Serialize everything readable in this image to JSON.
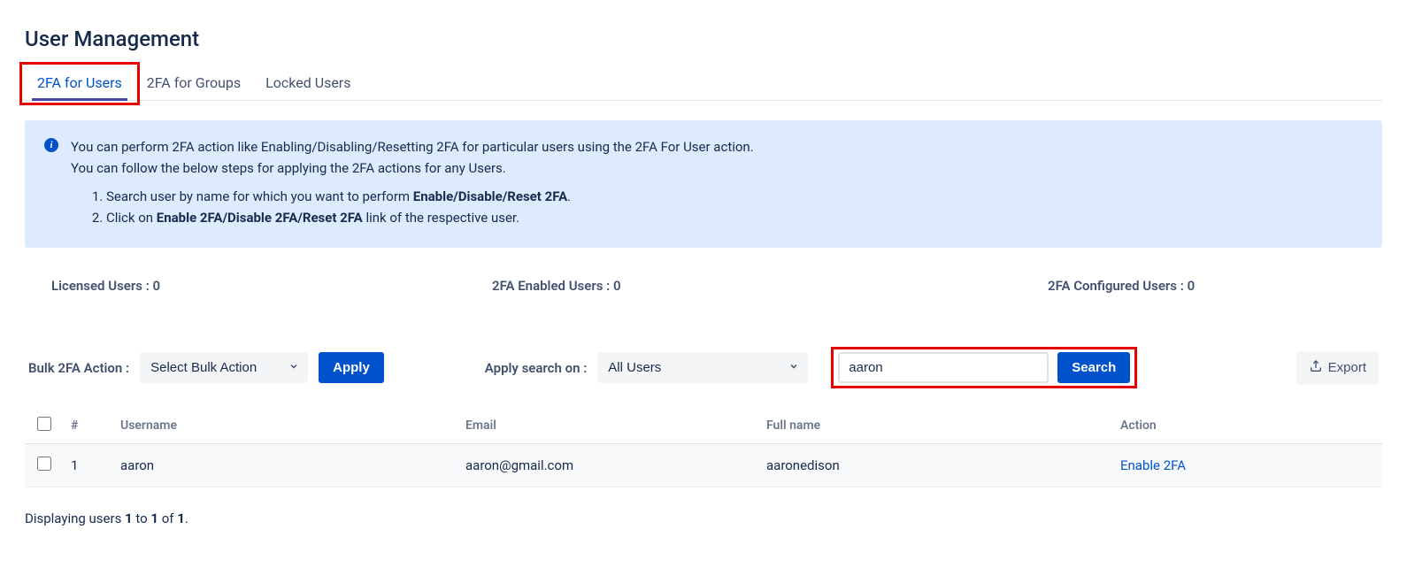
{
  "page": {
    "title": "User Management"
  },
  "tabs": [
    {
      "label": "2FA for Users",
      "active": true
    },
    {
      "label": "2FA for Groups",
      "active": false
    },
    {
      "label": "Locked Users",
      "active": false
    }
  ],
  "info": {
    "line1": "You can perform 2FA action like Enabling/Disabling/Resetting 2FA for particular users using the 2FA For User action.",
    "line2": "You can follow the below steps for applying the 2FA actions for any Users.",
    "step1_a": "Search user by name for which you want to perform ",
    "step1_b": "Enable/Disable/Reset 2FA",
    "step1_c": ".",
    "step2_a": "Click on ",
    "step2_b": "Enable 2FA/Disable 2FA/Reset 2FA",
    "step2_c": " link of the respective user."
  },
  "stats": {
    "licensed_label": "Licensed Users :",
    "licensed_value": "0",
    "enabled_label": "2FA Enabled Users :",
    "enabled_value": "0",
    "configured_label": "2FA Configured Users :",
    "configured_value": "0"
  },
  "controls": {
    "bulk_label": "Bulk 2FA Action :",
    "bulk_select": "Select Bulk Action",
    "apply": "Apply",
    "apply_search_label": "Apply search on :",
    "scope_select": "All Users",
    "search_value": "aaron",
    "search_button": "Search",
    "export": "Export"
  },
  "table": {
    "headers": {
      "num": "#",
      "username": "Username",
      "email": "Email",
      "fullname": "Full name",
      "action": "Action"
    },
    "rows": [
      {
        "num": "1",
        "username": "aaron",
        "email": "aaron@gmail.com",
        "fullname": "aaronedison",
        "action": "Enable 2FA"
      }
    ]
  },
  "footer": {
    "prefix": "Displaying users ",
    "from": "1",
    "mid1": " to ",
    "to": "1",
    "mid2": " of ",
    "total": "1",
    "suffix": "."
  }
}
